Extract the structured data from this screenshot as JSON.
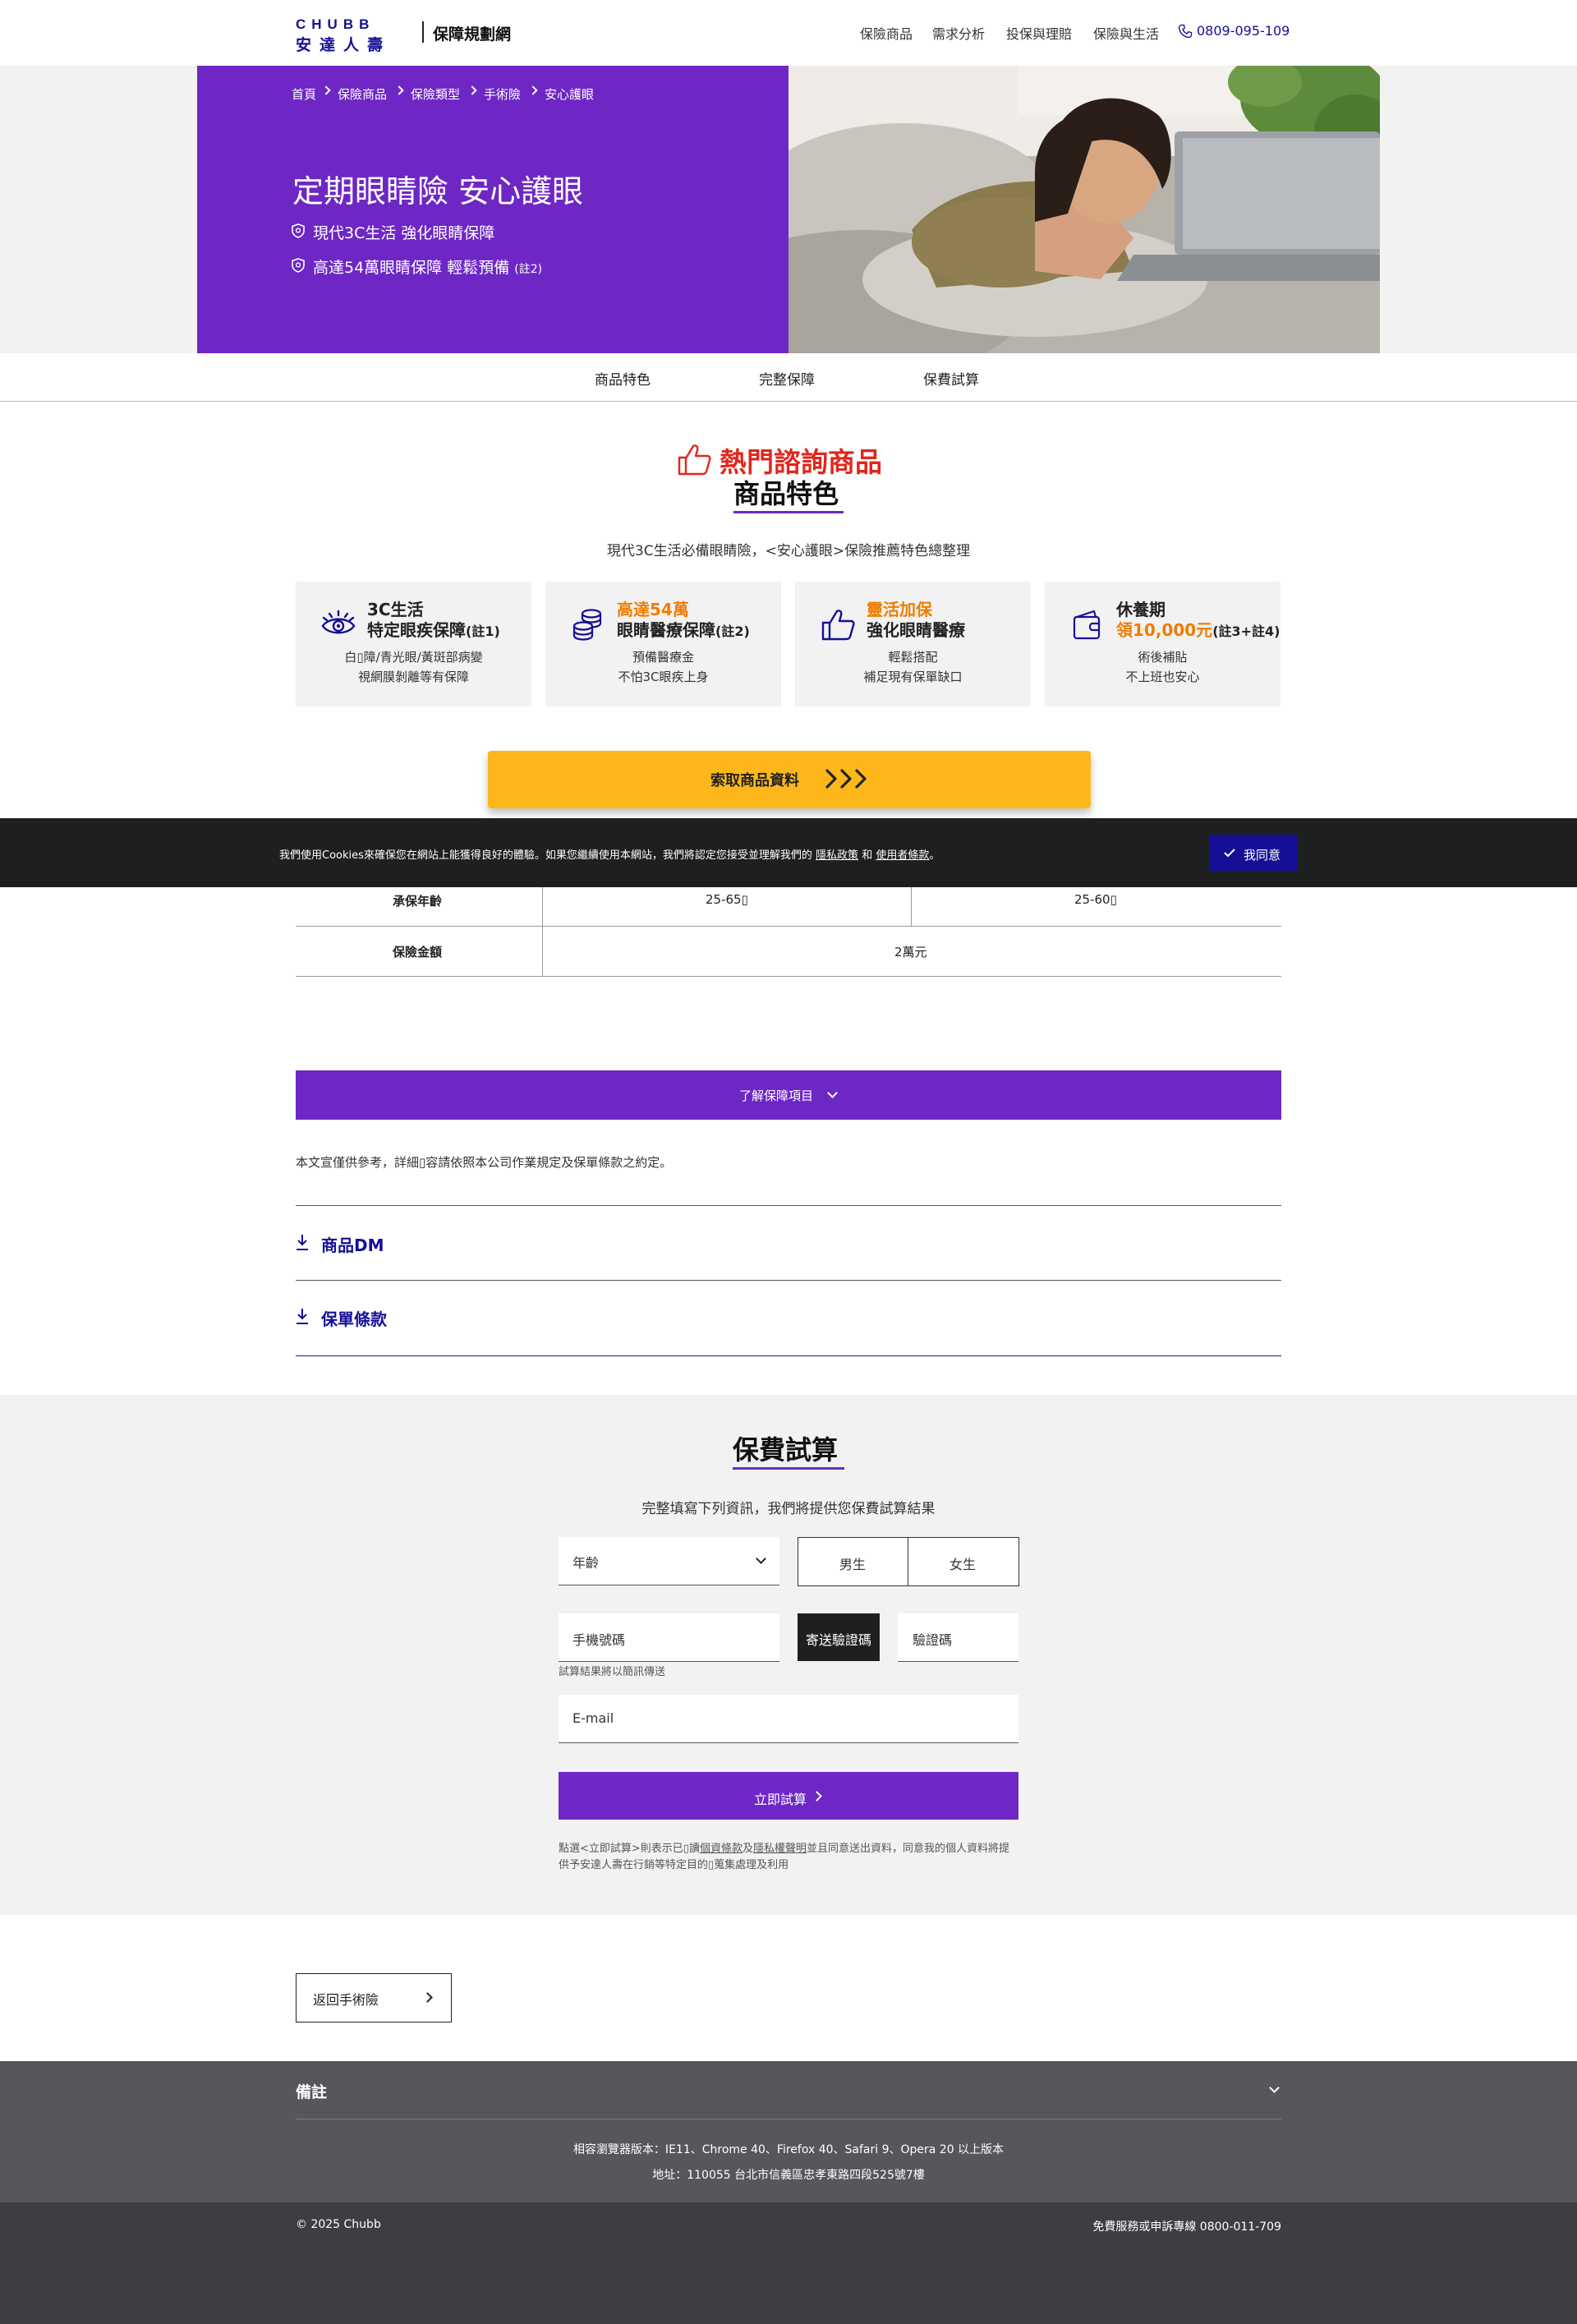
{
  "header": {
    "logo_text": "CHUBB",
    "logo_cn": "安達人壽",
    "site_name": "保障規劃網",
    "nav": [
      "保險商品",
      "需求分析",
      "投保與理賠",
      "保險與生活"
    ],
    "phone": "0809-095-109"
  },
  "hero": {
    "breadcrumb": [
      "首頁",
      "保險商品",
      "保險類型",
      "手術險",
      "安心護眼"
    ],
    "title": "定期眼睛險 安心護眼",
    "line1": "現代3C生活 強化眼睛保障",
    "line2": "高達54萬眼睛保障 輕鬆預備",
    "line2_note": "(註2)"
  },
  "tabs": [
    "商品特色",
    "完整保障",
    "保費試算"
  ],
  "features": {
    "hot_label": "熱門諮詢商品",
    "title": "商品特色",
    "subtitle": "現代3C生活必備眼睛險，<安心護眼>保險推薦特色總整理",
    "cards": [
      {
        "icon": "eye-icon",
        "h1": "3C生活",
        "h2": "特定眼疾保障",
        "note": "(註1)",
        "d1": "白▯障/青光眼/黃斑部病變",
        "d2": "視網膜剝離等有保障"
      },
      {
        "icon": "coins-icon",
        "h1": "高達54萬",
        "h2": "眼睛醫療保障",
        "note": "(註2)",
        "d1": "預備醫療金",
        "d2": "不怕3C眼疾上身"
      },
      {
        "icon": "thumbs-up-icon",
        "h1": "靈活加保",
        "h2": "強化眼睛醫療",
        "note": "",
        "d1": "輕鬆搭配",
        "d2": "補足現有保單缺口"
      },
      {
        "icon": "wallet-icon",
        "h1": "休養期",
        "h2": "領10,000元",
        "note": "(註3+註4)",
        "d1": "術後補貼",
        "d2": "不上班也安心"
      }
    ],
    "cta": "索取商品資料"
  },
  "cookie": {
    "text": "我們使用Cookies來確保您在網站上能獲得良好的體驗。如果您繼續使用本網站，我們將認定您接受並理解我們的",
    "privacy": "隱私政策",
    "and": "和",
    "terms": "使用者條款",
    "end": "。",
    "agree": "我同意"
  },
  "table": {
    "rows": [
      {
        "label": "承保年齡",
        "values": [
          "25-65▯",
          "25-60▯"
        ]
      },
      {
        "label": "保險金額",
        "values": [
          "2萬元"
        ]
      }
    ]
  },
  "coverage_button": "了解保障項目",
  "disclaimer": "本文宣僅供參考，詳細▯容請依照本公司作業規定及保單條款之約定。",
  "downloads": [
    "商品DM",
    "保單條款"
  ],
  "premium": {
    "title": "保費試算",
    "subtitle": "完整填寫下列資訊，我們將提供您保費試算結果",
    "age_placeholder": "年齡",
    "male": "男生",
    "female": "女生",
    "phone_placeholder": "手機號碼",
    "send_code": "寄送驗證碼",
    "code_placeholder": "驗證碼",
    "sms_hint": "試算結果將以簡訊傳送",
    "email_placeholder": "E-mail",
    "submit": "立即試算",
    "consent_1": "點選<立即試算>則表示已▯讀",
    "consent_link1": "個資條款",
    "consent_2": "及",
    "consent_link2": "隱私權聲明",
    "consent_3": "並且同意送出資料，同意我的個人資料將提供予安達人壽在行銷等特定目的▯蒐集處理及利用"
  },
  "back_button": "返回手術險",
  "footer": {
    "remarks": "備註",
    "browsers": "相容瀏覽器版本：IE11、Chrome 40、Firefox 40、Safari 9、Opera 20 以上版本",
    "address": "地址：110055 台北市信義區忠孝東路四段525號7樓",
    "copyright": "© 2025 Chubb",
    "hotline": "免費服務或申訴專線 0800-011-709"
  },
  "colors": {
    "brand_navy": "#150f96",
    "purple": "#6e27c5",
    "cta_yellow": "#fdb71a",
    "accent_red": "#e1261c",
    "accent_orange": "#ef7d00"
  }
}
